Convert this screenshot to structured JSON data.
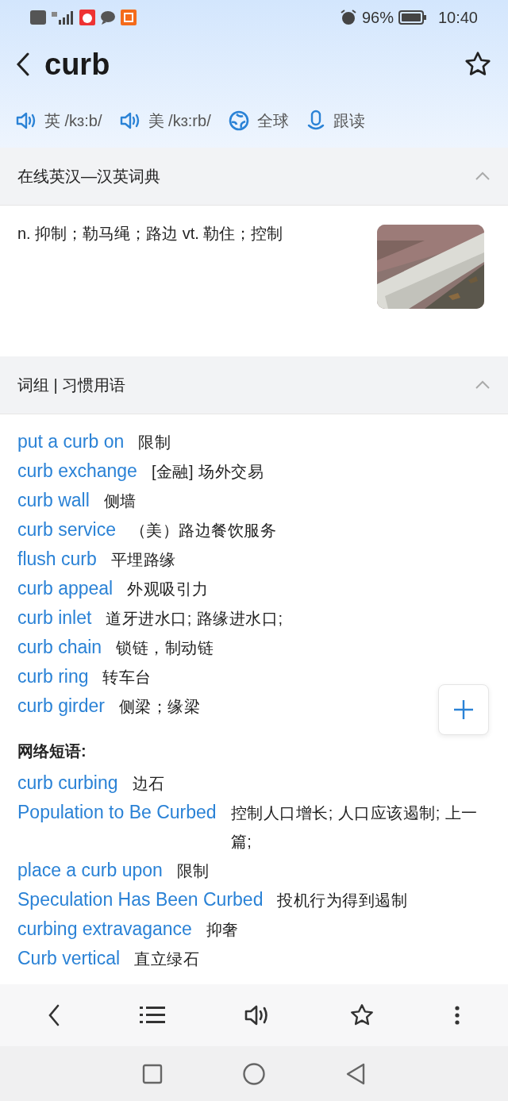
{
  "status_bar": {
    "battery": "96%",
    "time": "10:40"
  },
  "header": {
    "word": "curb"
  },
  "pronunciations": [
    {
      "label": "英 /kɜ:b/"
    },
    {
      "label": "美 /kɜ:rb/"
    }
  ],
  "actions": [
    {
      "kind": "globe",
      "label": "全球"
    },
    {
      "kind": "mic",
      "label": "跟读"
    }
  ],
  "dictionary": {
    "title": "在线英汉—汉英词典",
    "expanded": true,
    "definition": "n. 抑制；勒马绳；路边 vt. 勒住；控制"
  },
  "phrases_section": {
    "title": "词组 | 习惯用语",
    "expanded": true
  },
  "phrases": [
    {
      "en": "put a curb on",
      "zh": "限制"
    },
    {
      "en": "curb exchange",
      "zh": "[金融] 场外交易"
    },
    {
      "en": "curb wall",
      "zh": "侧墙"
    },
    {
      "en": "curb service",
      "zh": "（美）路边餐饮服务"
    },
    {
      "en": "flush curb",
      "zh": "平埋路缘"
    },
    {
      "en": "curb appeal",
      "zh": "外观吸引力"
    },
    {
      "en": "curb inlet",
      "zh": "道牙进水口; 路缘进水口;"
    },
    {
      "en": "curb chain",
      "zh": "锁链，制动链"
    },
    {
      "en": "curb ring",
      "zh": "转车台"
    },
    {
      "en": "curb girder",
      "zh": "侧梁；缘梁"
    }
  ],
  "net_phrases_title": "网络短语:",
  "net_phrases": [
    {
      "en": "curb curbing",
      "zh": "边石"
    },
    {
      "en": "Population to Be Curbed",
      "zh": "控制人口增长; 人口应该遏制; 上一篇;"
    },
    {
      "en": "place a curb upon",
      "zh": "限制"
    },
    {
      "en": "Speculation Has Been Curbed",
      "zh": "投机行为得到遏制"
    },
    {
      "en": "curbing extravagance",
      "zh": "抑奢"
    },
    {
      "en": "Curb vertical",
      "zh": "直立绿石"
    }
  ]
}
